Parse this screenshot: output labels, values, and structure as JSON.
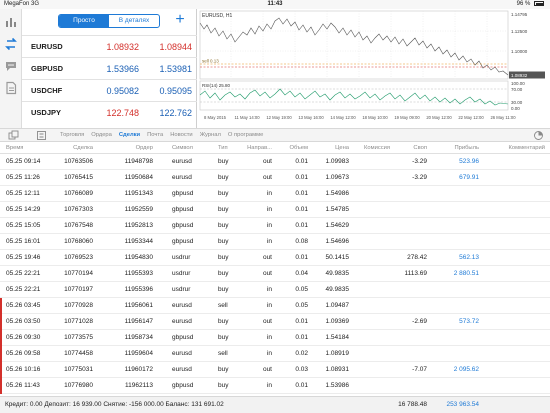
{
  "status_bar": {
    "carrier": "MegaFon",
    "network": "3G",
    "time": "11:43",
    "battery": "96 %"
  },
  "quotes_panel": {
    "mode_simple": "Просто",
    "mode_detail": "В деталях",
    "add_label": "+",
    "quotes": [
      {
        "symbol": "EURUSD",
        "bid": "1.08932",
        "ask": "1.08944",
        "bid_color": "#d3302b",
        "ask_color": "#d3302b"
      },
      {
        "symbol": "GBPUSD",
        "bid": "1.53966",
        "ask": "1.53981",
        "bid_color": "#1a5fb4",
        "ask_color": "#1a5fb4"
      },
      {
        "symbol": "USDCHF",
        "bid": "0.95082",
        "ask": "0.95095",
        "bid_color": "#1a5fb4",
        "ask_color": "#1a5fb4"
      },
      {
        "symbol": "USDJPY",
        "bid": "122.748",
        "ask": "122.762",
        "bid_color": "#d3302b",
        "ask_color": "#1a5fb4"
      }
    ]
  },
  "chart": {
    "title": "EURUSD, H1",
    "trade_label": "sell 0.13",
    "price_scale": [
      "1.14795",
      "1.12500",
      "1.10000",
      "1.08932"
    ],
    "rsi_label": "RSI(14) 25.80",
    "rsi_scale": [
      "100.00",
      "70.00",
      "30.00",
      "0.00"
    ],
    "time_labels": [
      "8 May 2015",
      "11 May 14:00",
      "12 May 19:00",
      "13 May 16:00",
      "14 May 12:00",
      "18 May 10:00",
      "19 May 09:00",
      "20 May 12:00",
      "22 May 12:00",
      "26 May 11:00"
    ]
  },
  "toolbar": {
    "tabs": [
      {
        "label": "Торговля",
        "active": false
      },
      {
        "label": "Ордера",
        "active": false
      },
      {
        "label": "Сделки",
        "active": true
      },
      {
        "label": "Почта",
        "active": false
      },
      {
        "label": "Новости",
        "active": false
      },
      {
        "label": "Журнал",
        "active": false
      },
      {
        "label": "О программе",
        "active": false
      }
    ]
  },
  "table": {
    "columns": [
      "Время",
      "Сделка",
      "Ордер",
      "Символ",
      "Тип",
      "Направ...",
      "Объем",
      "Цена",
      "Комиссия",
      "Своп",
      "Прибыль",
      "Комментарий"
    ],
    "rows": [
      {
        "time": "05.25 09:14",
        "deal": "10763506",
        "order": "11948798",
        "symbol": "eurusd",
        "type": "buy",
        "direction": "out",
        "volume": "0.01",
        "price": "1.09983",
        "commission": "",
        "swap": "-3.29",
        "profit": "523.96",
        "comment": "",
        "marked": false
      },
      {
        "time": "05.25 11:26",
        "deal": "10765415",
        "order": "11950684",
        "symbol": "eurusd",
        "type": "buy",
        "direction": "out",
        "volume": "0.01",
        "price": "1.09673",
        "commission": "",
        "swap": "-3.29",
        "profit": "679.91",
        "comment": "",
        "marked": false
      },
      {
        "time": "05.25 12:11",
        "deal": "10766089",
        "order": "11951343",
        "symbol": "gbpusd",
        "type": "buy",
        "direction": "in",
        "volume": "0.01",
        "price": "1.54986",
        "commission": "",
        "swap": "",
        "profit": "",
        "comment": "",
        "marked": false
      },
      {
        "time": "05.25 14:29",
        "deal": "10767303",
        "order": "11952559",
        "symbol": "gbpusd",
        "type": "buy",
        "direction": "in",
        "volume": "0.01",
        "price": "1.54785",
        "commission": "",
        "swap": "",
        "profit": "",
        "comment": "",
        "marked": false
      },
      {
        "time": "05.25 15:05",
        "deal": "10767548",
        "order": "11952813",
        "symbol": "gbpusd",
        "type": "buy",
        "direction": "in",
        "volume": "0.01",
        "price": "1.54629",
        "commission": "",
        "swap": "",
        "profit": "",
        "comment": "",
        "marked": false
      },
      {
        "time": "05.25 16:01",
        "deal": "10768060",
        "order": "11953344",
        "symbol": "gbpusd",
        "type": "buy",
        "direction": "in",
        "volume": "0.08",
        "price": "1.54696",
        "commission": "",
        "swap": "",
        "profit": "",
        "comment": "",
        "marked": false
      },
      {
        "time": "05.25 19:46",
        "deal": "10769523",
        "order": "11954830",
        "symbol": "usdrur",
        "type": "buy",
        "direction": "out",
        "volume": "0.01",
        "price": "50.1415",
        "commission": "",
        "swap": "278.42",
        "profit": "562.13",
        "comment": "",
        "marked": false
      },
      {
        "time": "05.25 22:21",
        "deal": "10770194",
        "order": "11955393",
        "symbol": "usdrur",
        "type": "buy",
        "direction": "out",
        "volume": "0.04",
        "price": "49.9835",
        "commission": "",
        "swap": "1113.69",
        "profit": "2 880.51",
        "comment": "",
        "marked": false
      },
      {
        "time": "05.25 22:21",
        "deal": "10770197",
        "order": "11955396",
        "symbol": "usdrur",
        "type": "buy",
        "direction": "in",
        "volume": "0.05",
        "price": "49.9835",
        "commission": "",
        "swap": "",
        "profit": "",
        "comment": "",
        "marked": false
      },
      {
        "time": "05.26 03:45",
        "deal": "10770928",
        "order": "11956061",
        "symbol": "eurusd",
        "type": "sell",
        "direction": "in",
        "volume": "0.05",
        "price": "1.09487",
        "commission": "",
        "swap": "",
        "profit": "",
        "comment": "",
        "marked": true
      },
      {
        "time": "05.26 03:50",
        "deal": "10771028",
        "order": "11956147",
        "symbol": "eurusd",
        "type": "buy",
        "direction": "out",
        "volume": "0.01",
        "price": "1.09369",
        "commission": "",
        "swap": "-2.69",
        "profit": "573.72",
        "comment": "",
        "marked": true
      },
      {
        "time": "05.26 09:30",
        "deal": "10773575",
        "order": "11958734",
        "symbol": "gbpusd",
        "type": "buy",
        "direction": "in",
        "volume": "0.01",
        "price": "1.54184",
        "commission": "",
        "swap": "",
        "profit": "",
        "comment": "",
        "marked": true
      },
      {
        "time": "05.26 09:58",
        "deal": "10774458",
        "order": "11959604",
        "symbol": "eurusd",
        "type": "sell",
        "direction": "in",
        "volume": "0.02",
        "price": "1.08919",
        "commission": "",
        "swap": "",
        "profit": "",
        "comment": "",
        "marked": true
      },
      {
        "time": "05.26 10:16",
        "deal": "10775031",
        "order": "11960172",
        "symbol": "eurusd",
        "type": "buy",
        "direction": "out",
        "volume": "0.03",
        "price": "1.08931",
        "commission": "",
        "swap": "-7.07",
        "profit": "2 095.62",
        "comment": "",
        "marked": true
      },
      {
        "time": "05.26 11:43",
        "deal": "10776980",
        "order": "11962113",
        "symbol": "gbpusd",
        "type": "buy",
        "direction": "in",
        "volume": "0.01",
        "price": "1.53986",
        "commission": "",
        "swap": "",
        "profit": "",
        "comment": "",
        "marked": true
      }
    ]
  },
  "footer": {
    "summary": "Кредит: 0.00 Депозит: 16 939.00 Снятие: -156 000.00 Баланс: 131 691.02",
    "swap_total": "16 788.48",
    "profit_total": "253 963.54"
  },
  "colors": {
    "accent": "#1e7ad6",
    "down": "#d3302b",
    "up": "#1a5fb4"
  }
}
